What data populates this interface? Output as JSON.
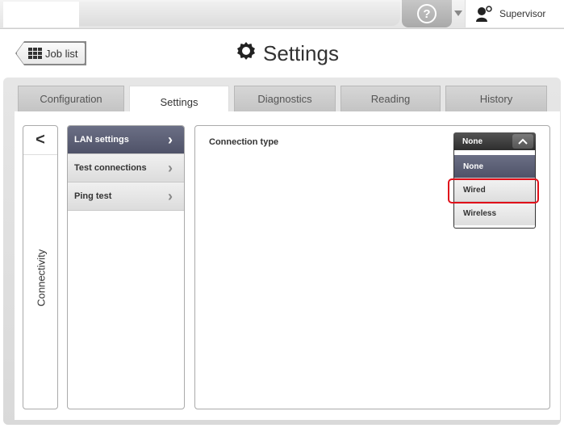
{
  "topbar": {
    "help_symbol": "?",
    "user_label": "Supervisor"
  },
  "header": {
    "back_label": "Job list",
    "title": "Settings"
  },
  "tabs": [
    {
      "label": "Configuration"
    },
    {
      "label": "Settings"
    },
    {
      "label": "Diagnostics"
    },
    {
      "label": "Reading"
    },
    {
      "label": "History"
    }
  ],
  "side": {
    "back_symbol": "<",
    "label": "Connectivity"
  },
  "menu": [
    {
      "label": "LAN settings"
    },
    {
      "label": "Test connections"
    },
    {
      "label": "Ping test"
    }
  ],
  "detail": {
    "connection_label": "Connection type",
    "selected_value": "None",
    "options": [
      {
        "label": "None"
      },
      {
        "label": "Wired"
      },
      {
        "label": "Wireless"
      }
    ]
  },
  "colors": {
    "active_item": "#4f5268",
    "highlight": "#e0101a"
  },
  "icons": {
    "help": "help-icon",
    "user": "user-settings-icon",
    "grid": "grid-icon",
    "gear": "gear-icon",
    "chevron": "chevron-right-icon"
  }
}
